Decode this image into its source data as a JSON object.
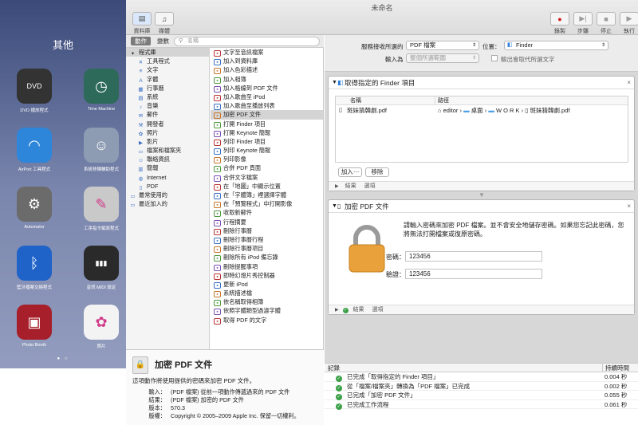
{
  "launchpad": {
    "title": "其他",
    "apps": [
      {
        "label": "DVD 播放程式",
        "icon": "dvd-icon",
        "glyph": "DVD",
        "bg": "#333333"
      },
      {
        "label": "Time Machine",
        "icon": "time-machine-icon",
        "glyph": "◷",
        "bg": "#2e6a5a"
      },
      {
        "label": "AirPort 工具程式",
        "icon": "airport-icon",
        "glyph": "◠",
        "bg": "#2d86d9"
      },
      {
        "label": "系統移轉輔助程式",
        "icon": "migration-icon",
        "glyph": "☺",
        "bg": "#8d9bb3"
      },
      {
        "label": "Automator",
        "icon": "automator-icon",
        "glyph": "⚙",
        "bg": "#6b6b6b"
      },
      {
        "label": "工序指令編寫程式",
        "icon": "script-editor-icon",
        "glyph": "✎",
        "bg": "#c9c9c9"
      },
      {
        "label": "藍牙檔案交換程式",
        "icon": "bluetooth-icon",
        "glyph": "ᛒ",
        "bg": "#1f63c9"
      },
      {
        "label": "音訊 MIDI 設定",
        "icon": "midi-icon",
        "glyph": "▮▮▮",
        "bg": "#2a2a2a"
      },
      {
        "label": "Photo Booth",
        "icon": "photo-booth-icon",
        "glyph": "▣",
        "bg": "#a61f2a"
      },
      {
        "label": "照片",
        "icon": "photos-icon",
        "glyph": "✿",
        "bg": "#f3f3f3"
      }
    ],
    "dots": "● ○"
  },
  "window": {
    "title": "未命名",
    "toolbar_left": [
      {
        "label": "資料庫",
        "icon": "library-icon",
        "glyph": "▤"
      },
      {
        "label": "媒體",
        "icon": "media-icon",
        "glyph": "♫"
      }
    ],
    "toolbar_right": [
      {
        "label": "錄製",
        "icon": "record-icon",
        "glyph": "●"
      },
      {
        "label": "步驟",
        "icon": "step-icon",
        "glyph": "▶|"
      },
      {
        "label": "停止",
        "icon": "stop-icon",
        "glyph": "■"
      },
      {
        "label": "執行",
        "icon": "run-icon",
        "glyph": "▶"
      }
    ]
  },
  "library": {
    "tabs": [
      "動作",
      "變數"
    ],
    "search_placeholder": "名稱",
    "categories": [
      {
        "label": "程式庫",
        "icon": "library-folder-icon",
        "glyph": "▾"
      },
      {
        "label": "工具程式",
        "icon": "utilities-icon",
        "glyph": "✕"
      },
      {
        "label": "文字",
        "icon": "text-icon",
        "glyph": "≡"
      },
      {
        "label": "字體",
        "icon": "fonts-icon",
        "glyph": "A"
      },
      {
        "label": "行事曆",
        "icon": "calendar-icon",
        "glyph": "▦"
      },
      {
        "label": "系統",
        "icon": "system-icon",
        "glyph": "▤"
      },
      {
        "label": "音樂",
        "icon": "music-icon",
        "glyph": "♪"
      },
      {
        "label": "郵件",
        "icon": "mail-icon",
        "glyph": "✉"
      },
      {
        "label": "開發者",
        "icon": "developer-icon",
        "glyph": "⚒"
      },
      {
        "label": "照片",
        "icon": "photos-cat-icon",
        "glyph": "✿"
      },
      {
        "label": "影片",
        "icon": "movies-icon",
        "glyph": "▶"
      },
      {
        "label": "檔案和檔案夾",
        "icon": "files-icon",
        "glyph": "▭"
      },
      {
        "label": "聯絡資訊",
        "icon": "contacts-icon",
        "glyph": "☺"
      },
      {
        "label": "簡報",
        "icon": "presentation-icon",
        "glyph": "▥"
      },
      {
        "label": "Internet",
        "icon": "internet-icon",
        "glyph": "◍"
      },
      {
        "label": "PDF",
        "icon": "pdf-cat-icon",
        "glyph": "▯"
      },
      {
        "label": "最常使用的",
        "icon": "most-used-icon",
        "glyph": "▭"
      },
      {
        "label": "最近加入的",
        "icon": "recently-added-icon",
        "glyph": "▭"
      }
    ],
    "actions": [
      "文字至音訊檔案",
      "加入到資料庫",
      "加入色彩描述",
      "加入相簿",
      "加入格線到 PDF 文件",
      "加入歌曲至 iPod",
      "加入歌曲至播放列表",
      "加密 PDF 文件",
      "打開 Finder 項目",
      "打開 Keynote 簡報",
      "列印 Finder 項目",
      "列印 Keynote 簡報",
      "列印影像",
      "合併 PDF 頁面",
      "合併文字檔案",
      "在「地圖」中顯示位置",
      "在「字體簿」裡選擇字體",
      "在「預覽程式」中打開影像",
      "收取新郵件",
      "行程摘要",
      "刪除行事曆",
      "刪除行事曆行程",
      "刪除行事曆項目",
      "刪除所有 iPod 備忘錄",
      "刪除提醒事項",
      "即時幻燈片秀控制器",
      "更新 iPod",
      "系統描述檔",
      "依名稱取得相簿",
      "依照字體類型過濾字體",
      "取得 PDF 的文字"
    ],
    "selected_action": "加密 PDF 文件"
  },
  "description": {
    "title": "加密 PDF 文件",
    "summary": "這項動作將使用提供的密碼來加密 PDF 文件。",
    "rows": [
      {
        "key": "輸入：",
        "value": "(PDF 檔案) 從前一項動作傳遞過來的 PDF 文件"
      },
      {
        "key": "結果：",
        "value": "(PDF 檔案) 加密的 PDF 文件"
      },
      {
        "key": "版本：",
        "value": "570.3"
      },
      {
        "key": "版權：",
        "value": "Copyright © 2005–2009 Apple Inc. 保留一切權利。"
      }
    ]
  },
  "workflow": {
    "receives_label": "服務接收所選的",
    "receives_value": "PDF 檔案",
    "location_label": "位置：",
    "location_value": "Finder",
    "input_label": "輸入為",
    "input_value": "整個所選範圍",
    "replace_text_label": "輸出會取代所選文字",
    "card1": {
      "title": "取得指定的 Finder 項目",
      "col_name": "名稱",
      "col_path": "路徑",
      "file_name": "斑妹猜韓劇.pdf",
      "path": [
        "editor",
        "桌面",
        "W O R K",
        "斑妹猜韓劇.pdf"
      ],
      "add_button": "加入⋯",
      "remove_button": "移除",
      "results": "結果",
      "options": "選項"
    },
    "card2": {
      "title": "加密 PDF 文件",
      "message": "請輸入密碼來加密 PDF 檔案。並不會安全地儲存密碼。如果您忘記此密碼，您將無法打開檔案或復原密碼。",
      "password_label": "密碼：",
      "password_value": "123456",
      "verify_label": "驗證：",
      "verify_value": "123456",
      "results": "結果",
      "options": "選項"
    }
  },
  "log": {
    "col_log": "記錄",
    "col_duration": "持續時間",
    "rows": [
      {
        "text": "已完成「取得指定的 Finder 項目」",
        "time": "0.004 秒"
      },
      {
        "text": "從「檔案/檔案夾」轉換為「PDF 檔案」已完成",
        "time": "0.002 秒"
      },
      {
        "text": "已完成「加密 PDF 文件」",
        "time": "0.055 秒"
      },
      {
        "text": "已完成工作流程",
        "time": "0.061 秒"
      }
    ]
  }
}
